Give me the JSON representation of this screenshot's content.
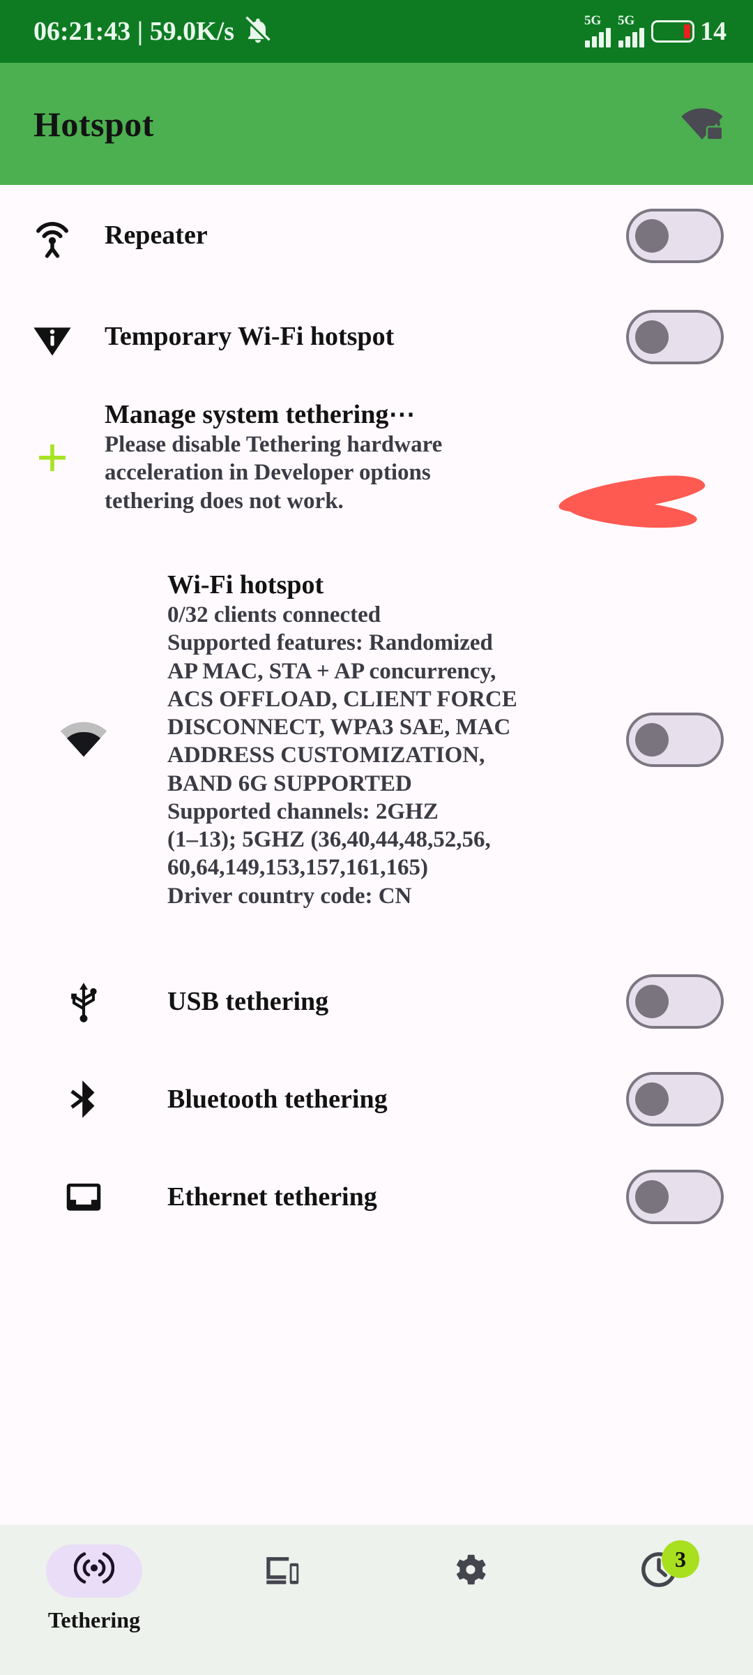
{
  "status_bar": {
    "clock": "06:21:43 | 59.0K/s",
    "mute_icon": "bell-mute-icon",
    "network_label_1": "5G",
    "network_label_2": "5G",
    "battery_percent": "14",
    "battery_color": "#E8201E",
    "background": "#0E7B23"
  },
  "header": {
    "title": "Hotspot",
    "redacted": true,
    "redaction_color": "#FF5A52",
    "right_icon": "wifi-lock-icon",
    "background": "#4CB050"
  },
  "rows": {
    "repeater": {
      "icon": "repeater-antenna-icon",
      "title": "Repeater",
      "toggle_state": "off"
    },
    "temporary": {
      "icon": "info-pin-icon",
      "title": "Temporary Wi-Fi hotspot",
      "toggle_state": "off"
    },
    "manage": {
      "icon": "plus-icon",
      "icon_color": "#A6E423",
      "title": "Manage system tethering⋯",
      "sub_line_1": "Please disable Tethering hardware",
      "sub_line_2": "acceleration in Developer options",
      "sub_line_3": "tethering does not work."
    },
    "wifi_hotspot": {
      "icon": "wifi-signal-icon",
      "title": "Wi-Fi hotspot",
      "sub_lines": [
        "0/32 clients connected",
        "Supported features: Randomized",
        "AP MAC, STA + AP concurrency,",
        "ACS OFFLOAD, CLIENT FORCE",
        "DISCONNECT, WPA3 SAE, MAC",
        "ADDRESS CUSTOMIZATION,",
        "BAND 6G SUPPORTED",
        "Supported channels: 2GHZ",
        "(1–13); 5GHZ (36,40,44,48,52,56,",
        "60,64,149,153,157,161,165)",
        "Driver country code: CN"
      ],
      "toggle_state": "off"
    },
    "usb": {
      "icon": "usb-icon",
      "title": "USB tethering",
      "toggle_state": "off"
    },
    "bluetooth": {
      "icon": "bluetooth-icon",
      "title": "Bluetooth tethering",
      "toggle_state": "off"
    },
    "ethernet": {
      "icon": "ethernet-icon",
      "title": "Ethernet tethering",
      "toggle_state": "off"
    }
  },
  "bottom_nav": {
    "background": "#EDF2EC",
    "items": [
      {
        "icon": "hotspot-icon",
        "label": "Tethering",
        "active": true
      },
      {
        "icon": "devices-icon",
        "label": "",
        "active": false
      },
      {
        "icon": "gear-icon",
        "label": "",
        "active": false
      },
      {
        "icon": "history-clock-icon",
        "label": "",
        "active": false,
        "badge": "3",
        "badge_color": "#A8E020"
      }
    ]
  }
}
